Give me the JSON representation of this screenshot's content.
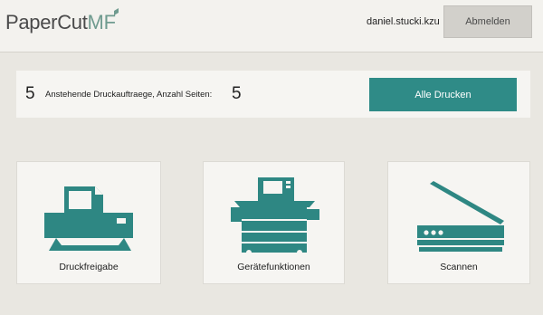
{
  "header": {
    "logo_main": "PaperCut",
    "logo_suffix": "MF",
    "username": "daniel.stucki.kzu",
    "logout_label": "Abmelden"
  },
  "jobs": {
    "pending_count": "5",
    "description": "Anstehende Druckauftraege, Anzahl Seiten:",
    "page_count": "5",
    "print_all_label": "Alle Drucken"
  },
  "tiles": [
    {
      "label": "Druckfreigabe",
      "icon": "printer-icon"
    },
    {
      "label": "Gerätefunktionen",
      "icon": "copier-icon"
    },
    {
      "label": "Scannen",
      "icon": "scanner-icon"
    }
  ],
  "colors": {
    "accent": "#2f8b87",
    "icon": "#2e8783",
    "background": "#e9e7e1",
    "logo_suffix": "#6f9b8f"
  }
}
